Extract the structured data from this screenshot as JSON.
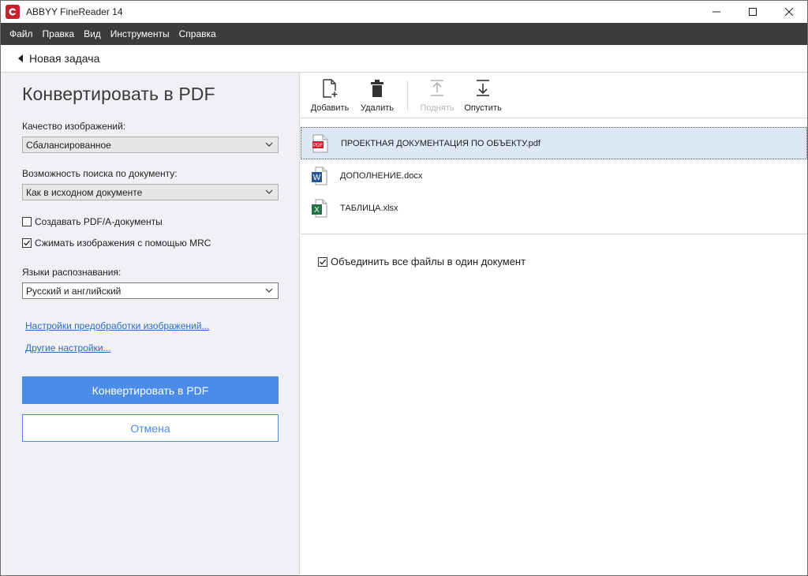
{
  "window": {
    "title": "ABBYY FineReader 14"
  },
  "menu": {
    "items": [
      "Файл",
      "Правка",
      "Вид",
      "Инструменты",
      "Справка"
    ]
  },
  "nav": {
    "back_label": "Новая задача"
  },
  "left_panel": {
    "title": "Конвертировать в PDF",
    "image_quality": {
      "label": "Качество изображений:",
      "value": "Сбалансированное"
    },
    "searchability": {
      "label": "Возможность поиска по документу:",
      "value": "Как в исходном документе"
    },
    "pdfa_checkbox": {
      "label": "Создавать PDF/A-документы",
      "checked": false
    },
    "mrc_checkbox": {
      "label": "Сжимать изображения с помощью MRC",
      "checked": true
    },
    "languages": {
      "label": "Языки распознавания:",
      "value": "Русский и английский"
    },
    "links": {
      "preprocessing": "Настройки предобработки изображений...",
      "other": "Другие настройки..."
    },
    "convert_button": "Конвертировать в PDF",
    "cancel_button": "Отмена"
  },
  "toolbar": {
    "add": "Добавить",
    "delete": "Удалить",
    "move_up": "Поднять",
    "move_down": "Опустить"
  },
  "files": [
    {
      "name": "ПРОЕКТНАЯ ДОКУМЕНТАЦИЯ ПО ОБЪЕКТУ.pdf",
      "type": "pdf",
      "icon_text": "PDF",
      "selected": true
    },
    {
      "name": "ДОПОЛНЕНИЕ.docx",
      "type": "docx",
      "icon_text": "W",
      "selected": false
    },
    {
      "name": "ТАБЛИЦА.xlsx",
      "type": "xlsx",
      "icon_text": "X",
      "selected": false
    }
  ],
  "merge_checkbox": {
    "label": "Объединить все файлы в один документ",
    "checked": true
  },
  "colors": {
    "accent": "#4a8ce8",
    "menubar": "#3c3c3c",
    "panel_bg": "#eff1f4",
    "selected_row": "#dde8f6",
    "link": "#2a6cc2",
    "pdf_red": "#c8202c",
    "word_blue": "#2b579a",
    "excel_green": "#217346"
  }
}
